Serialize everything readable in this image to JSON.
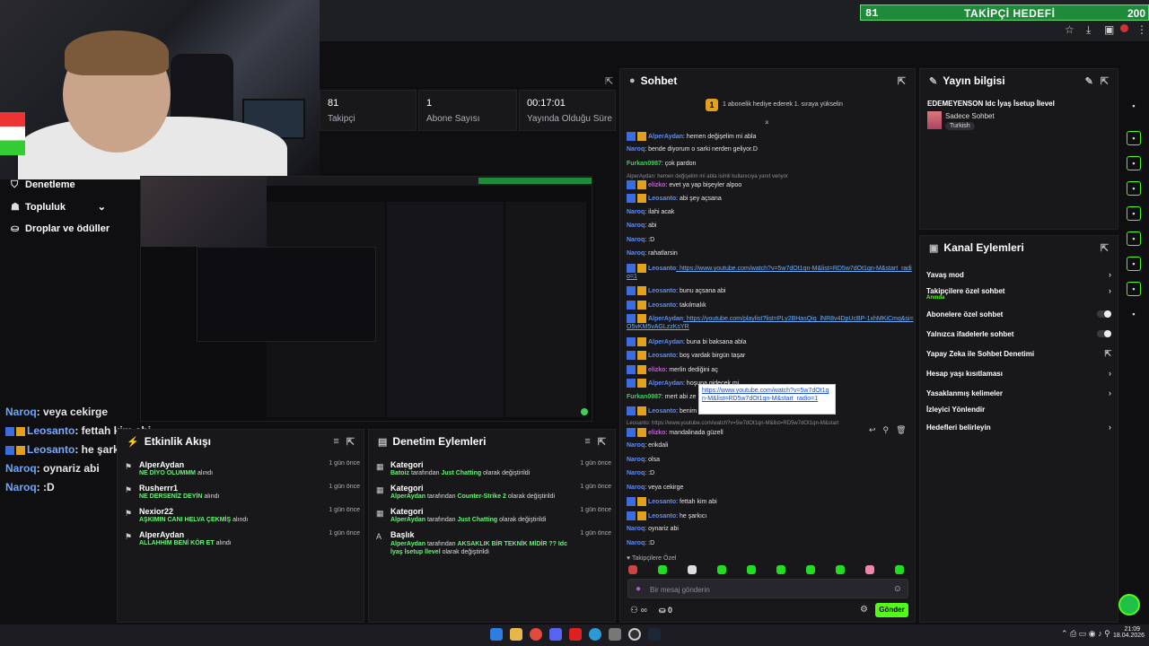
{
  "goal": {
    "count": "81",
    "label": "TAKİPÇİ HEDEFİ",
    "target": "200"
  },
  "stats": [
    {
      "value": "81",
      "label": "Takipçi"
    },
    {
      "value": "1",
      "label": "Abone Sayısı"
    },
    {
      "value": "00:17:01",
      "label": "Yayında Olduğu Süre"
    }
  ],
  "nav": [
    {
      "label": "Denetleme",
      "icon": "shield-icon"
    },
    {
      "label": "Topluluk",
      "icon": "users-icon"
    },
    {
      "label": "Droplar ve ödüller",
      "icon": "gift-icon"
    }
  ],
  "overlay_chat": [
    {
      "user": "Naroq",
      "text": ": veya cekirge"
    },
    {
      "user": "Leosanto",
      "text": ": fettah kim abi"
    },
    {
      "user": "Leosanto",
      "text": ": he şarkıcı"
    },
    {
      "user": "Naroq",
      "text": ": oynariz abi"
    },
    {
      "user": "Naroq",
      "text": ": :D"
    }
  ],
  "activity": {
    "title": "Etkinlik Akışı",
    "items": [
      {
        "name": "AlperAydan",
        "msg": "NE DİYO OLUMMM",
        "suffix": "alındı",
        "time": "1 gün önce"
      },
      {
        "name": "Rusherrr1",
        "msg": "NE DERSENİZ DEYİN",
        "suffix": "alındı",
        "time": "1 gün önce"
      },
      {
        "name": "Nexior22",
        "msg": "AŞKIMIN CANI HELVA ÇEKMİŞ",
        "suffix": "alındı",
        "time": "1 gün önce"
      },
      {
        "name": "AlperAydan",
        "msg": "ALLAHHIM BENİ KÖR ET",
        "suffix": "alındı",
        "time": "1 gün önce"
      }
    ]
  },
  "moderation": {
    "title": "Denetim Eylemleri",
    "items": [
      {
        "type": "Kategori",
        "user": "Batoiz",
        "mid": "tarafından",
        "value": "Just Chatting",
        "end": "olarak değiştirildi",
        "time": "1 gün önce"
      },
      {
        "type": "Kategori",
        "user": "AlperAydan",
        "mid": "tarafından",
        "value": "Counter-Strike 2",
        "end": "olarak değiştirildi",
        "time": "1 gün önce"
      },
      {
        "type": "Kategori",
        "user": "AlperAydan",
        "mid": "tarafından",
        "value": "Just Chatting",
        "end": "olarak değiştirildi",
        "time": "1 gün önce"
      },
      {
        "type": "Başlık",
        "user": "AlperAydan",
        "mid": "tarafından",
        "value": "AKSAKLIK BİR TEKNİK MİDİR ?? Idc İyaş İsetup İlevel",
        "end": "olarak değiştirildi",
        "time": "1 gün önce"
      }
    ]
  },
  "chat": {
    "title": "Sohbet",
    "promo": "1 abonelik hediye ederek 1. sıraya yükselin",
    "promo_rank": "1",
    "messages": [
      {
        "user": "AlperAydan",
        "color": "blue",
        "badges": true,
        "text": ": hemen değişelim mi abla"
      },
      {
        "user": "Naroq",
        "color": "blue",
        "badges": false,
        "text": ": bende diyorum o sarki nerden geliyor.D"
      },
      {
        "user": "Furkan0987",
        "color": "green",
        "badges": false,
        "text": ": çok pardon"
      },
      {
        "user": "",
        "color": "reply",
        "badges": false,
        "text": "AlperAydan: hemen değişelim mi abla isimli kullanıcıya yanıt veriyor"
      },
      {
        "user": "elizko",
        "color": "pink",
        "badges": true,
        "text": ": evet ya yap bişeyler alpoo"
      },
      {
        "user": "Leosanto",
        "color": "blue",
        "badges": true,
        "text": ": abi şey açsana"
      },
      {
        "user": "Naroq",
        "color": "blue",
        "badges": false,
        "text": ": ilahi acak"
      },
      {
        "user": "Naroq",
        "color": "blue",
        "badges": false,
        "text": ": abi"
      },
      {
        "user": "Naroq",
        "color": "blue",
        "badges": false,
        "text": ": :D"
      },
      {
        "user": "Naroq",
        "color": "blue",
        "badges": false,
        "text": ": rahatlarsin"
      },
      {
        "user": "Leosanto",
        "color": "blue",
        "badges": true,
        "text": ": https://www.youtube.com/watch?v=5w7dOt1qn-M&list=RD5w7dOt1qn-M&start_radio=1"
      },
      {
        "user": "Leosanto",
        "color": "blue",
        "badges": true,
        "text": ": bunu açsana abi"
      },
      {
        "user": "Leosanto",
        "color": "blue",
        "badges": true,
        "text": ": takılmalık"
      },
      {
        "user": "AlperAydan",
        "color": "blue",
        "badges": true,
        "text": ": https://youtube.com/playlist?list=PLy2BHasQiq_lNR8v4DpUcBP-1xhMKiCmq&si=O5vKM5vAGLzzKsYR"
      },
      {
        "user": "AlperAydan",
        "color": "blue",
        "badges": true,
        "text": ": buna bi baksana abla"
      },
      {
        "user": "Leosanto",
        "color": "blue",
        "badges": true,
        "text": ": boş vardak birgün taşar"
      },
      {
        "user": "elizko",
        "color": "pink",
        "badges": true,
        "text": ": merlin dediğini aç"
      },
      {
        "user": "AlperAydan",
        "color": "blue",
        "badges": true,
        "text": ": hoşuna gidecek mi"
      },
      {
        "user": "Furkan0987",
        "color": "green",
        "badges": false,
        "text": ": mert abi ze"
      },
      {
        "user": "Leosanto",
        "color": "blue",
        "badges": true,
        "text": ": benim"
      },
      {
        "user": "",
        "color": "reply",
        "badges": false,
        "text": "Leosanto: https://www.youtube.com/watch?v=5w7dOt1qn-M&list=RD5w7dOt1qn-M&start"
      },
      {
        "user": "elizko",
        "color": "pink",
        "badges": true,
        "text": ": mandalinada güzell"
      },
      {
        "user": "Naroq",
        "color": "blue",
        "badges": false,
        "text": ": erikdali"
      },
      {
        "user": "Naroq",
        "color": "blue",
        "badges": false,
        "text": ": olsa"
      },
      {
        "user": "Naroq",
        "color": "blue",
        "badges": false,
        "text": ": :D"
      },
      {
        "user": "Naroq",
        "color": "blue",
        "badges": false,
        "text": ": veya cekirge"
      },
      {
        "user": "Leosanto",
        "color": "blue",
        "badges": true,
        "text": ": fettah kim abi"
      },
      {
        "user": "Leosanto",
        "color": "blue",
        "badges": true,
        "text": ": he şarkıcı"
      },
      {
        "user": "Naroq",
        "color": "blue",
        "badges": false,
        "text": ": oynariz abi"
      },
      {
        "user": "Naroq",
        "color": "blue",
        "badges": false,
        "text": ": :D"
      }
    ],
    "tooltip": "https://www.youtube.com/watch?v=5w7dOt1qn-M&list=RD5w7dOt1qn-M&start_radio=1",
    "followers_only": "Takipçilere Özel",
    "input_placeholder": "Bir mesaj gönderin",
    "infinity": "∞",
    "points": "0",
    "send": "Gönder"
  },
  "stream_info": {
    "title": "Yayın bilgisi",
    "stream_title": "EDEMEYENSON Idc İyaş İsetup İlevel",
    "category": "Sadece Sohbet",
    "tag": "Turkish"
  },
  "channel_actions": {
    "title": "Kanal Eylemleri",
    "items": [
      {
        "label": "Yavaş mod",
        "sub": "",
        "control": "chevron"
      },
      {
        "label": "Takipçilere özel sohbet",
        "sub": "Anında",
        "control": "chevron"
      },
      {
        "label": "Abonelere özel sohbet",
        "sub": "",
        "control": "toggle"
      },
      {
        "label": "Yalnızca ifadelerle sohbet",
        "sub": "",
        "control": "toggle"
      },
      {
        "label": "Yapay Zeka ile Sohbet Denetimi",
        "sub": "",
        "control": "external"
      },
      {
        "label": "Hesap yaşı kısıtlaması",
        "sub": "",
        "control": "chevron"
      },
      {
        "label": "Yasaklanmış kelimeler",
        "sub": "",
        "control": "chevron"
      },
      {
        "label": "İzleyici Yönlendir",
        "sub": "",
        "control": "none"
      },
      {
        "label": "Hedefleri belirleyin",
        "sub": "",
        "control": "chevron"
      }
    ]
  },
  "taskbar": {
    "time": "21:09",
    "date": "18.04.2026"
  },
  "colors": {
    "accent": "#53fc18",
    "brand_green": "#1f8a3a"
  }
}
